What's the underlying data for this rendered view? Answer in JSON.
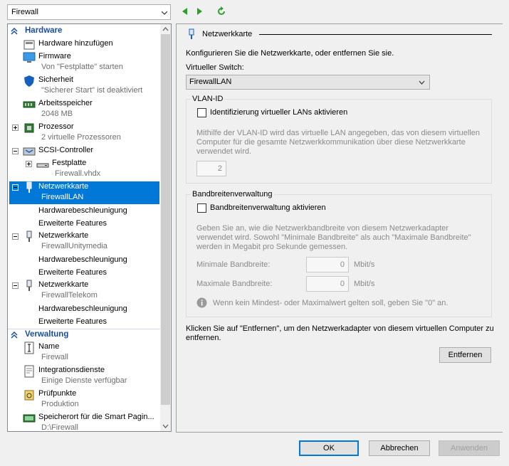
{
  "vm_selector": {
    "value": "Firewall"
  },
  "tree": {
    "hardware_header": "Hardware",
    "items": [
      {
        "label": "Hardware hinzufügen"
      },
      {
        "label": "Firmware",
        "sub": "Von \"Festplatte\" starten"
      },
      {
        "label": "Sicherheit",
        "sub": "\"Sicherer Start\" ist deaktiviert"
      },
      {
        "label": "Arbeitsspeicher",
        "sub": "2048 MB"
      },
      {
        "label": "Prozessor",
        "sub": "2 virtuelle Prozessoren"
      },
      {
        "label": "SCSI-Controller"
      },
      {
        "label": "Festplatte",
        "sub": "Firewall.vhdx"
      },
      {
        "label": "Netzwerkkarte",
        "sub": "FirewallLAN"
      },
      {
        "label": "Hardwarebeschleunigung"
      },
      {
        "label": "Erweiterte Features"
      },
      {
        "label": "Netzwerkkarte",
        "sub": "FirewallUnitymedia"
      },
      {
        "label": "Hardwarebeschleunigung"
      },
      {
        "label": "Erweiterte Features"
      },
      {
        "label": "Netzwerkkarte",
        "sub": "FirewallTelekom"
      },
      {
        "label": "Hardwarebeschleunigung"
      },
      {
        "label": "Erweiterte Features"
      }
    ],
    "management_header": "Verwaltung",
    "mgmt": [
      {
        "label": "Name",
        "sub": "Firewall"
      },
      {
        "label": "Integrationsdienste",
        "sub": "Einige Dienste verfügbar"
      },
      {
        "label": "Prüfpunkte",
        "sub": "Produktion"
      },
      {
        "label": "Speicherort für die Smart Pagin...",
        "sub": "D:\\Firewall"
      }
    ]
  },
  "panel": {
    "title": "Netzwerkkarte",
    "intro": "Konfigurieren Sie die Netzwerkkarte, oder entfernen Sie sie.",
    "switch_label": "Virtueller Switch:",
    "switch_value": "FirewallLAN",
    "vlan_group": "VLAN-ID",
    "vlan_checkbox": "Identifizierung virtueller LANs aktivieren",
    "vlan_desc": "Mithilfe der VLAN-ID wird das virtuelle LAN angegeben, das von diesem virtuellen Computer für die gesamte Netzwerkkommunikation über diese Netzwerkkarte verwendet wird.",
    "vlan_value": "2",
    "bw_group": "Bandbreitenverwaltung",
    "bw_checkbox": "Bandbreitenverwaltung aktivieren",
    "bw_desc": "Geben Sie an, wie die Netzwerkbandbreite von diesem Netzwerkadapter verwendet wird. Sowohl \"Minimale Bandbreite\" als auch \"Maximale Bandbreite\" werden in Megabit pro Sekunde gemessen.",
    "min_label": "Minimale Bandbreite:",
    "min_value": "0",
    "max_label": "Maximale Bandbreite:",
    "max_value": "0",
    "unit": "Mbit/s",
    "info": "Wenn kein Mindest- oder Maximalwert gelten soll, geben Sie \"0\" an.",
    "remove_text": "Klicken Sie auf \"Entfernen\", um den Netzwerkadapter von diesem virtuellen Computer zu entfernen.",
    "remove_button": "Entfernen"
  },
  "footer": {
    "ok": "OK",
    "cancel": "Abbrechen",
    "apply": "Anwenden"
  },
  "colors": {
    "selection": "#0078d7",
    "category": "#1a4e9c",
    "nav_arrow": "#2d9e2d"
  }
}
